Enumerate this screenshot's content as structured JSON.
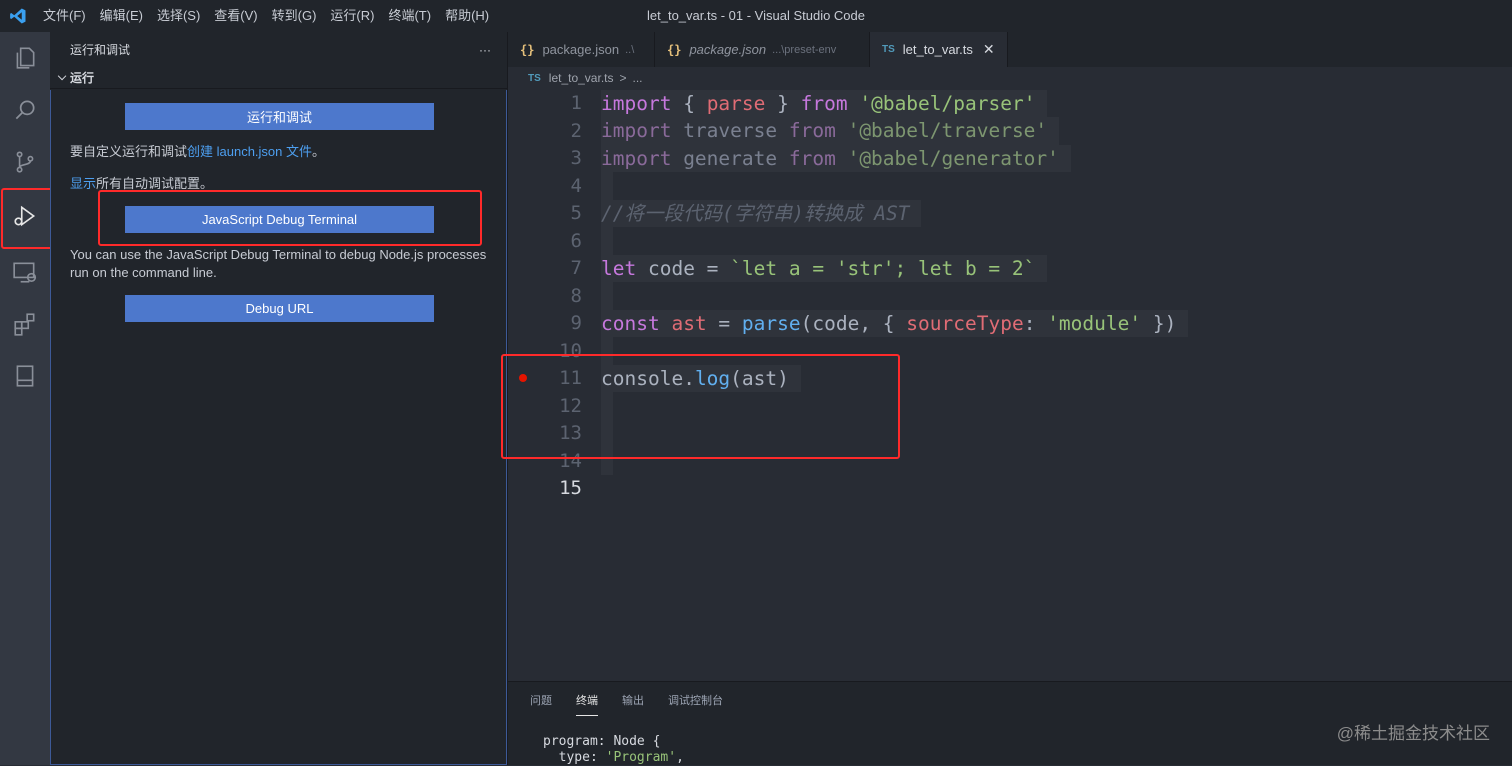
{
  "window": {
    "title": "let_to_var.ts - 01 - Visual Studio Code"
  },
  "menu": [
    "文件(F)",
    "编辑(E)",
    "选择(S)",
    "查看(V)",
    "转到(G)",
    "运行(R)",
    "终端(T)",
    "帮助(H)"
  ],
  "activity_bar": [
    "explorer-icon",
    "search-icon",
    "source-control-icon",
    "run-debug-icon",
    "remote-explorer-icon",
    "extensions-icon",
    "bookmark-icon"
  ],
  "sidebar": {
    "title": "运行和调试",
    "more": "···",
    "section": "运行",
    "run_button": "运行和调试",
    "customize_prefix": "要自定义运行和调试",
    "customize_link": "创建 launch.json 文件",
    "customize_suffix": "。",
    "show_link": "显示",
    "show_suffix": "所有自动调试配置。",
    "js_debug_button": "JavaScript Debug Terminal",
    "js_debug_desc": "You can use the JavaScript Debug Terminal to debug Node.js processes run on the command line.",
    "debug_url_button": "Debug URL"
  },
  "tabs": [
    {
      "icon": "{}",
      "label": "package.json",
      "desc": "..\\"
    },
    {
      "icon": "{}",
      "label": "package.json",
      "desc": "...\\preset-env"
    },
    {
      "icon": "TS",
      "label": "let_to_var.ts",
      "close": "✕"
    }
  ],
  "breadcrumb": {
    "icon": "TS",
    "file": "let_to_var.ts",
    "sep": ">",
    "rest": "..."
  },
  "editor": {
    "line_numbers": [
      "1",
      "2",
      "3",
      "4",
      "5",
      "6",
      "7",
      "8",
      "9",
      "10",
      "11",
      "12",
      "13",
      "14",
      "15"
    ],
    "lines": {
      "l1": [
        "import",
        " { ",
        "parse",
        " } ",
        "from",
        " ",
        "'@babel/parser'"
      ],
      "l2": [
        "import",
        " traverse ",
        "from",
        " ",
        "'@babel/traverse'"
      ],
      "l3": [
        "import",
        " generate ",
        "from",
        " ",
        "'@babel/generator'"
      ],
      "l5": "//将一段代码(字符串)转换成 AST",
      "l7": [
        "let",
        " code = ",
        "`let a = 'str'; let b = 2`"
      ],
      "l9": [
        "const",
        " ",
        "ast",
        " = ",
        "parse",
        "(code, { ",
        "sourceType",
        ": ",
        "'module'",
        " })"
      ],
      "l11": [
        "console",
        ".",
        "log",
        "(ast)"
      ]
    }
  },
  "panel": {
    "tabs": [
      "问题",
      "终端",
      "输出",
      "调试控制台"
    ],
    "active_tab": "终端",
    "terminal_lines": {
      "line1": "program: Node {",
      "line2_key": "  type: ",
      "line2_val": "'Program'",
      "line2_end": ","
    }
  },
  "watermark": "@稀土掘金技术社区",
  "colors": {
    "accent": "#4d78cc",
    "highlight_box": "#ff2a2a",
    "breakpoint": "#e51400"
  }
}
